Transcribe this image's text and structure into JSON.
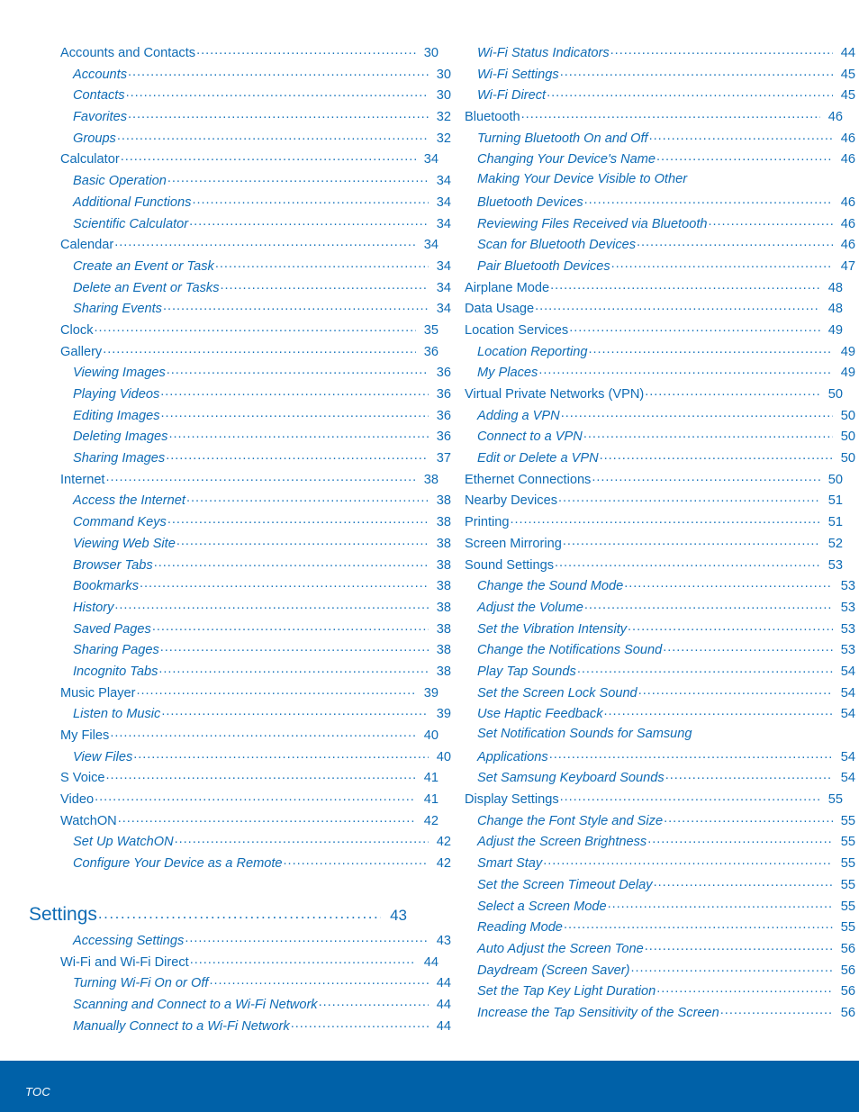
{
  "document": {
    "type": "table-of-contents",
    "accent_color": "#0F6CB5",
    "footer_color": "#0061A8",
    "footer_text_color": "#FFFFFF"
  },
  "footer": {
    "label": "TOC"
  },
  "left_column": [
    {
      "level": 1,
      "label": "Accounts and Contacts",
      "page": "30"
    },
    {
      "level": 2,
      "label": "Accounts",
      "page": "30"
    },
    {
      "level": 2,
      "label": "Contacts",
      "page": "30"
    },
    {
      "level": 2,
      "label": "Favorites",
      "page": "32"
    },
    {
      "level": 2,
      "label": "Groups",
      "page": "32"
    },
    {
      "level": 1,
      "label": "Calculator",
      "page": "34"
    },
    {
      "level": 2,
      "label": "Basic Operation",
      "page": "34"
    },
    {
      "level": 2,
      "label": "Additional Functions",
      "page": "34"
    },
    {
      "level": 2,
      "label": "Scientific Calculator",
      "page": "34"
    },
    {
      "level": 1,
      "label": "Calendar",
      "page": "34"
    },
    {
      "level": 2,
      "label": "Create an Event or Task",
      "page": "34"
    },
    {
      "level": 2,
      "label": "Delete an Event or Tasks",
      "page": "34"
    },
    {
      "level": 2,
      "label": "Sharing Events",
      "page": "34"
    },
    {
      "level": 1,
      "label": "Clock",
      "page": "35"
    },
    {
      "level": 1,
      "label": "Gallery",
      "page": "36"
    },
    {
      "level": 2,
      "label": "Viewing Images",
      "page": "36"
    },
    {
      "level": 2,
      "label": "Playing Videos",
      "page": "36"
    },
    {
      "level": 2,
      "label": "Editing Images",
      "page": "36"
    },
    {
      "level": 2,
      "label": "Deleting Images",
      "page": "36"
    },
    {
      "level": 2,
      "label": "Sharing Images",
      "page": "37"
    },
    {
      "level": 1,
      "label": "Internet",
      "page": "38"
    },
    {
      "level": 2,
      "label": "Access the Internet",
      "page": "38"
    },
    {
      "level": 2,
      "label": "Command Keys",
      "page": "38"
    },
    {
      "level": 2,
      "label": "Viewing Web Site",
      "page": "38"
    },
    {
      "level": 2,
      "label": "Browser Tabs",
      "page": "38"
    },
    {
      "level": 2,
      "label": "Bookmarks",
      "page": "38"
    },
    {
      "level": 2,
      "label": "History",
      "page": "38"
    },
    {
      "level": 2,
      "label": "Saved Pages",
      "page": "38"
    },
    {
      "level": 2,
      "label": "Sharing Pages",
      "page": "38"
    },
    {
      "level": 2,
      "label": "Incognito Tabs",
      "page": "38"
    },
    {
      "level": 1,
      "label": "Music Player",
      "page": "39"
    },
    {
      "level": 2,
      "label": "Listen to Music",
      "page": "39"
    },
    {
      "level": 1,
      "label": "My Files",
      "page": "40"
    },
    {
      "level": 2,
      "label": "View Files",
      "page": "40"
    },
    {
      "level": 1,
      "label": "S Voice",
      "page": "41"
    },
    {
      "level": 1,
      "label": "Video",
      "page": "41"
    },
    {
      "level": 1,
      "label": "WatchON",
      "page": "42"
    },
    {
      "level": 2,
      "label": "Set Up WatchON",
      "page": "42"
    },
    {
      "level": 2,
      "label": "Configure Your Device as a Remote",
      "page": "42"
    },
    {
      "level": "spacer"
    },
    {
      "level": 0,
      "label": "Settings",
      "page": "43"
    },
    {
      "level": 2,
      "label": "Accessing Settings",
      "page": "43"
    },
    {
      "level": 1,
      "label": "Wi-Fi and Wi-Fi Direct",
      "page": "44"
    },
    {
      "level": 2,
      "label": "Turning Wi-Fi On or Off",
      "page": "44"
    },
    {
      "level": 2,
      "label": "Scanning and Connect to a Wi-Fi Network",
      "page": "44"
    },
    {
      "level": 2,
      "label": "Manually Connect to a Wi-Fi Network",
      "page": "44"
    }
  ],
  "right_column": [
    {
      "level": 2,
      "label": "Wi-Fi Status Indicators",
      "page": "44"
    },
    {
      "level": 2,
      "label": "Wi-Fi Settings",
      "page": "45"
    },
    {
      "level": 2,
      "label": "Wi-Fi Direct",
      "page": "45"
    },
    {
      "level": 1,
      "label": "Bluetooth",
      "page": "46"
    },
    {
      "level": 2,
      "label": "Turning Bluetooth On and Off",
      "page": "46"
    },
    {
      "level": 2,
      "label": "Changing Your Device's Name",
      "page": "46"
    },
    {
      "level": 2,
      "label": "Making Your Device Visible to Other",
      "page": "",
      "wrap_first": true
    },
    {
      "level": 2,
      "label": "Bluetooth Devices",
      "page": "46"
    },
    {
      "level": 2,
      "label": "Reviewing Files Received via Bluetooth",
      "page": "46"
    },
    {
      "level": 2,
      "label": "Scan for Bluetooth Devices",
      "page": "46"
    },
    {
      "level": 2,
      "label": "Pair Bluetooth Devices",
      "page": "47"
    },
    {
      "level": 1,
      "label": "Airplane Mode",
      "page": "48"
    },
    {
      "level": 1,
      "label": "Data Usage",
      "page": "48"
    },
    {
      "level": 1,
      "label": "Location Services",
      "page": "49"
    },
    {
      "level": 2,
      "label": "Location Reporting",
      "page": "49"
    },
    {
      "level": 2,
      "label": "My Places",
      "page": "49"
    },
    {
      "level": 1,
      "label": "Virtual Private Networks (VPN)",
      "page": "50"
    },
    {
      "level": 2,
      "label": "Adding a VPN",
      "page": "50"
    },
    {
      "level": 2,
      "label": "Connect to a VPN",
      "page": "50"
    },
    {
      "level": 2,
      "label": "Edit or Delete a VPN",
      "page": "50"
    },
    {
      "level": 1,
      "label": "Ethernet Connections",
      "page": "50"
    },
    {
      "level": 1,
      "label": "Nearby Devices",
      "page": "51"
    },
    {
      "level": 1,
      "label": "Printing",
      "page": "51"
    },
    {
      "level": 1,
      "label": "Screen Mirroring",
      "page": "52"
    },
    {
      "level": 1,
      "label": "Sound Settings",
      "page": "53"
    },
    {
      "level": 2,
      "label": "Change the Sound Mode",
      "page": "53"
    },
    {
      "level": 2,
      "label": "Adjust the Volume",
      "page": "53"
    },
    {
      "level": 2,
      "label": "Set the Vibration Intensity",
      "page": "53"
    },
    {
      "level": 2,
      "label": "Change the Notifications Sound",
      "page": "53"
    },
    {
      "level": 2,
      "label": "Play Tap Sounds",
      "page": "54"
    },
    {
      "level": 2,
      "label": "Set the Screen Lock Sound",
      "page": "54"
    },
    {
      "level": 2,
      "label": "Use Haptic Feedback",
      "page": "54"
    },
    {
      "level": 2,
      "label": "Set Notification Sounds for Samsung",
      "page": "",
      "wrap_first": true
    },
    {
      "level": 2,
      "label": "Applications",
      "page": "54"
    },
    {
      "level": 2,
      "label": "Set Samsung Keyboard Sounds",
      "page": "54"
    },
    {
      "level": 1,
      "label": "Display Settings",
      "page": "55"
    },
    {
      "level": 2,
      "label": "Change the Font Style and Size",
      "page": "55"
    },
    {
      "level": 2,
      "label": "Adjust the Screen Brightness",
      "page": "55"
    },
    {
      "level": 2,
      "label": "Smart Stay",
      "page": "55"
    },
    {
      "level": 2,
      "label": "Set the Screen Timeout Delay",
      "page": "55"
    },
    {
      "level": 2,
      "label": "Select a Screen Mode",
      "page": "55"
    },
    {
      "level": 2,
      "label": "Reading Mode",
      "page": "55"
    },
    {
      "level": 2,
      "label": "Auto Adjust the Screen Tone",
      "page": "56"
    },
    {
      "level": 2,
      "label": "Daydream (Screen Saver)",
      "page": "56"
    },
    {
      "level": 2,
      "label": "Set the Tap Key Light Duration",
      "page": "56"
    },
    {
      "level": 2,
      "label": "Increase the Tap Sensitivity of the Screen",
      "page": "56"
    }
  ]
}
